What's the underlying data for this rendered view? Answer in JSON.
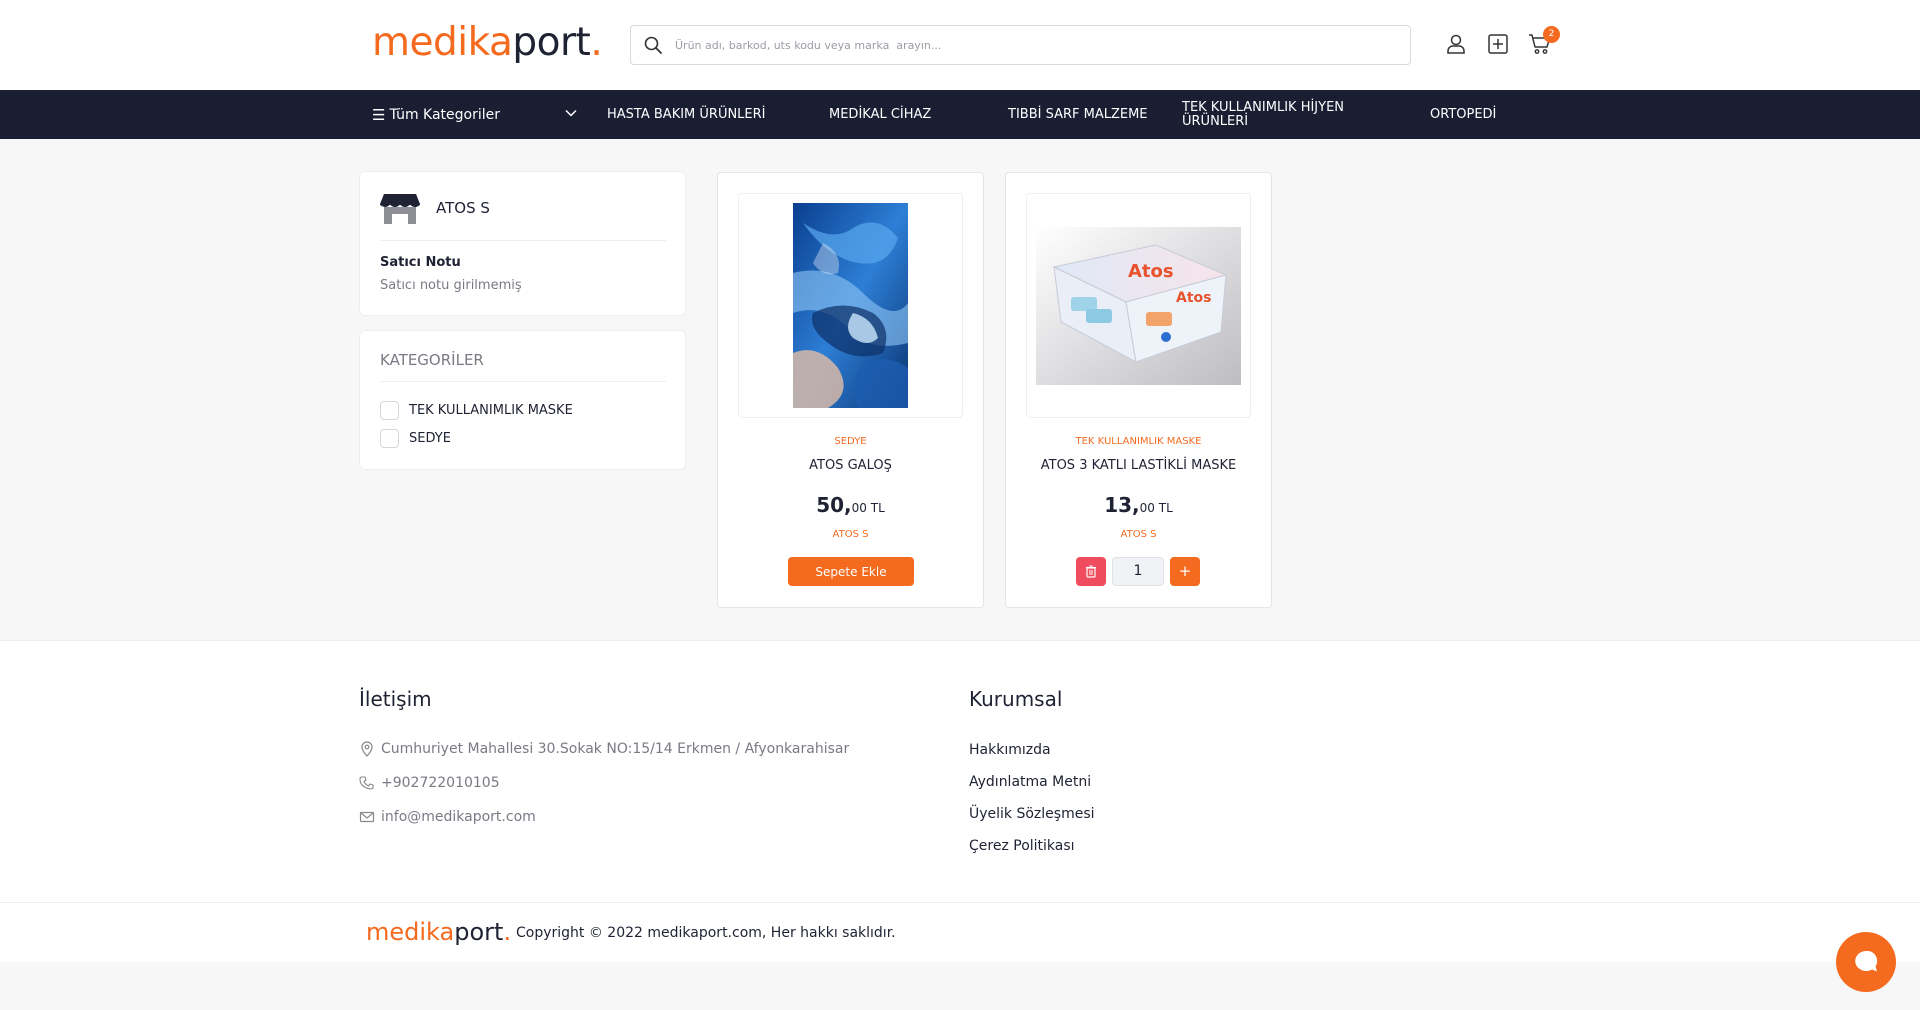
{
  "header": {
    "logo_part1": "medika",
    "logo_part2": "port",
    "logo_dot": ".",
    "search_placeholder": "Ürün adı, barkod, uts kodu veya marka  arayın...",
    "cart_count": "2"
  },
  "nav": {
    "all_categories": "Tüm Kategoriler",
    "items": [
      "HASTA BAKIM ÜRÜNLERİ",
      "MEDİKAL CİHAZ",
      "TIBBİ SARF MALZEME",
      "TEK KULLANIMLIK HİJYEN ÜRÜNLERİ",
      "ORTOPEDİ"
    ]
  },
  "seller": {
    "name": "ATOS S",
    "note_title": "Satıcı Notu",
    "note_value": "Satıcı notu girilmemiş"
  },
  "categories": {
    "title": "KATEGORİLER",
    "options": [
      "TEK KULLANIMLIK MASKE",
      "SEDYE"
    ]
  },
  "products": [
    {
      "category": "SEDYE",
      "name": "ATOS GALOŞ",
      "price_int": "50,",
      "price_dec": "00 TL",
      "seller": "ATOS S",
      "button": "Sepete Ekle"
    },
    {
      "category": "TEK KULLANIMLIK MASKE",
      "name": "ATOS 3 KATLI LASTİKLİ MASKE",
      "price_int": "13,",
      "price_dec": "00 TL",
      "seller": "ATOS S",
      "quantity": "1",
      "plus": "+",
      "box_brand": "Atos"
    }
  ],
  "footer": {
    "contact_title": "İletişim",
    "address": "Cumhuriyet Mahallesi 30.Sokak NO:15/14 Erkmen / Afyonkarahisar",
    "phone": "+902722010105",
    "email": "info@medikaport.com",
    "corporate_title": "Kurumsal",
    "links": [
      "Hakkımızda",
      "Aydınlatma Metni",
      "Üyelik Sözleşmesi",
      "Çerez Politikası"
    ],
    "copyright": "Copyright © 2022 medikaport.com, Her hakkı saklıdır."
  },
  "colors": {
    "accent": "#f46a1f",
    "nav_bg": "#1a1e33",
    "danger": "#ef4d5e"
  }
}
